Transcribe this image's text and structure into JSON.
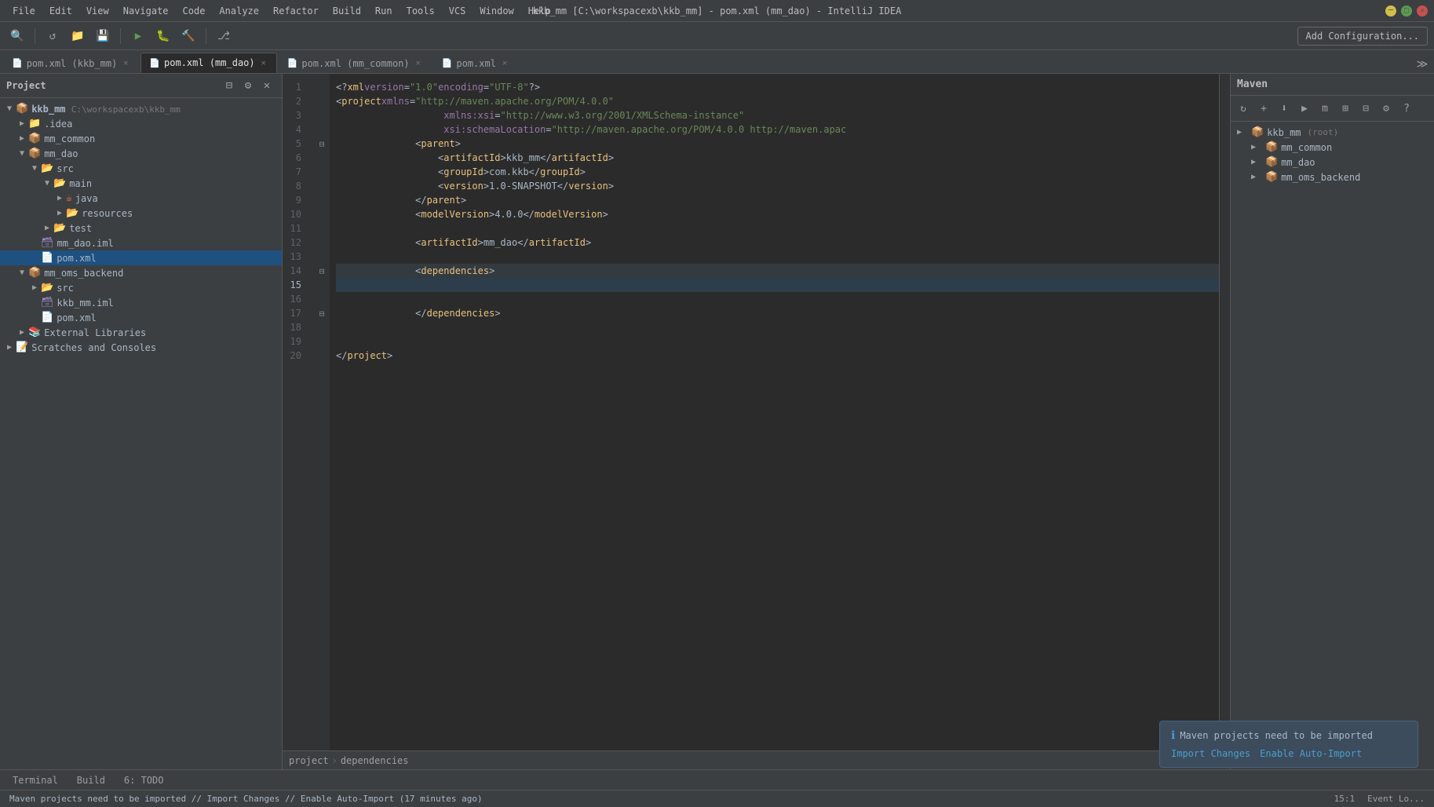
{
  "window": {
    "title": "kkb_mm [C:\\workspacexb\\kkb_mm] - pom.xml (mm_dao) - IntelliJ IDEA",
    "menus": [
      "File",
      "Edit",
      "View",
      "Navigate",
      "Code",
      "Analyze",
      "Refactor",
      "Build",
      "Run",
      "Tools",
      "VCS",
      "Window",
      "Help"
    ]
  },
  "toolbar": {
    "add_config_label": "Add Configuration..."
  },
  "tabs": [
    {
      "icon": "xml",
      "label": "pom.xml (kkb_mm)",
      "active": false
    },
    {
      "icon": "xml",
      "label": "pom.xml (mm_dao)",
      "active": true
    },
    {
      "icon": "xml",
      "label": "pom.xml (mm_common)",
      "active": false
    },
    {
      "icon": "xml",
      "label": "pom.xml",
      "active": false
    }
  ],
  "sidebar": {
    "title": "Project",
    "tree": [
      {
        "level": 0,
        "expanded": true,
        "type": "module",
        "label": "kkb_mm",
        "note": "C:\\workspacexb\\kkb_mm"
      },
      {
        "level": 1,
        "expanded": false,
        "type": "folder-hidden",
        "label": ".idea"
      },
      {
        "level": 1,
        "expanded": true,
        "type": "module",
        "label": "mm_common"
      },
      {
        "level": 1,
        "expanded": true,
        "type": "module",
        "label": "mm_dao"
      },
      {
        "level": 2,
        "expanded": true,
        "type": "folder-src",
        "label": "src"
      },
      {
        "level": 3,
        "expanded": true,
        "type": "folder-main",
        "label": "main"
      },
      {
        "level": 4,
        "expanded": false,
        "type": "folder-java",
        "label": "java"
      },
      {
        "level": 4,
        "expanded": false,
        "type": "folder-res",
        "label": "resources"
      },
      {
        "level": 3,
        "expanded": false,
        "type": "folder-test",
        "label": "test"
      },
      {
        "level": 2,
        "expanded": false,
        "type": "iml",
        "label": "mm_dao.iml"
      },
      {
        "level": 2,
        "expanded": false,
        "type": "xml",
        "label": "pom.xml",
        "selected": true
      },
      {
        "level": 1,
        "expanded": true,
        "type": "module",
        "label": "mm_oms_backend"
      },
      {
        "level": 2,
        "expanded": false,
        "type": "folder-src",
        "label": "src"
      },
      {
        "level": 2,
        "expanded": false,
        "type": "iml",
        "label": "kkb_mm.iml"
      },
      {
        "level": 2,
        "expanded": false,
        "type": "xml",
        "label": "pom.xml"
      },
      {
        "level": 1,
        "expanded": false,
        "type": "extlibs",
        "label": "External Libraries"
      },
      {
        "level": 1,
        "expanded": false,
        "type": "scratches",
        "label": "Scratches and Consoles"
      }
    ]
  },
  "editor": {
    "filename": "pom.xml",
    "lines": [
      {
        "num": 1,
        "content": "<?xml version=\"1.0\" encoding=\"UTF-8\"?>"
      },
      {
        "num": 2,
        "content": "<project xmlns=\"http://maven.apache.org/POM/4.0.0\""
      },
      {
        "num": 3,
        "content": "         xmlns:xsi=\"http://www.w3.org/2001/XMLSchema-instance\""
      },
      {
        "num": 4,
        "content": "         xsi:schemaLocation=\"http://maven.apache.org/POM/4.0.0 http://maven.apac"
      },
      {
        "num": 5,
        "content": "    <parent>"
      },
      {
        "num": 6,
        "content": "        <artifactId>kkb_mm</artifactId>"
      },
      {
        "num": 7,
        "content": "        <groupId>com.kkb</groupId>"
      },
      {
        "num": 8,
        "content": "        <version>1.0-SNAPSHOT</version>"
      },
      {
        "num": 9,
        "content": "    </parent>"
      },
      {
        "num": 10,
        "content": "    <modelVersion>4.0.0</modelVersion>"
      },
      {
        "num": 11,
        "content": ""
      },
      {
        "num": 12,
        "content": "    <artifactId>mm_dao</artifactId>"
      },
      {
        "num": 13,
        "content": ""
      },
      {
        "num": 14,
        "content": "    <dependencies>"
      },
      {
        "num": 15,
        "content": "        |",
        "cursor": true
      },
      {
        "num": 16,
        "content": ""
      },
      {
        "num": 17,
        "content": "    </dependencies>"
      },
      {
        "num": 18,
        "content": ""
      },
      {
        "num": 19,
        "content": ""
      },
      {
        "num": 20,
        "content": "</project>"
      }
    ]
  },
  "breadcrumb": {
    "items": [
      "project",
      "dependencies"
    ]
  },
  "maven": {
    "title": "Maven",
    "modules": [
      {
        "label": "kkb_mm",
        "note": "(root)",
        "expanded": false
      },
      {
        "label": "mm_common",
        "expanded": false
      },
      {
        "label": "mm_dao",
        "expanded": false
      },
      {
        "label": "mm_oms_backend",
        "expanded": false
      }
    ]
  },
  "notification": {
    "message": "Maven projects need to be imported",
    "action1": "Import Changes",
    "action2": "Enable Auto-Import"
  },
  "bottom_tabs": [
    {
      "label": "Terminal"
    },
    {
      "label": "Build"
    },
    {
      "label": "6: TODO",
      "number": "6"
    }
  ],
  "status_bar": {
    "message": "Maven projects need to be imported // Import Changes // Enable Auto-Import (17 minutes ago)",
    "position": "15:1",
    "event_log": "Event Lo..."
  }
}
